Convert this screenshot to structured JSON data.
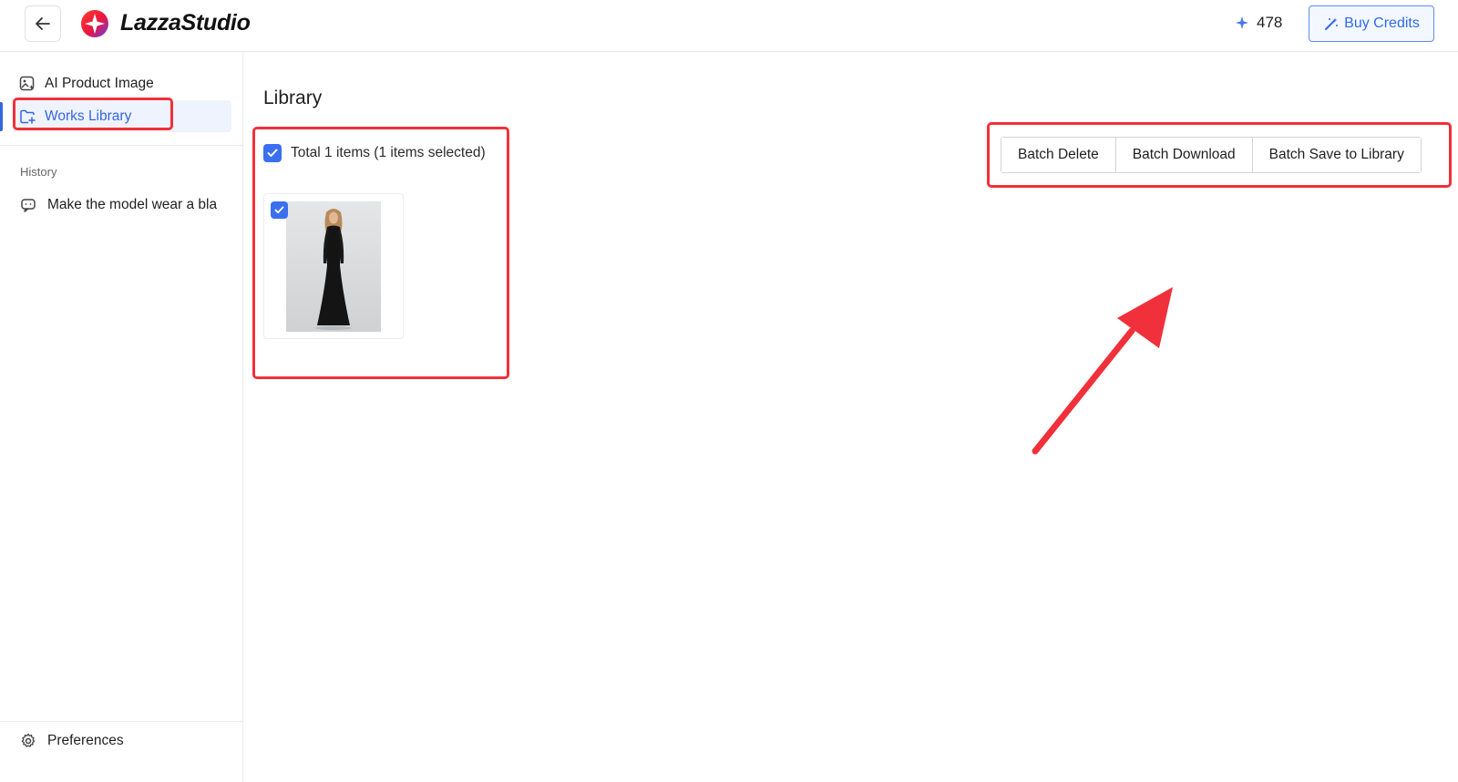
{
  "header": {
    "brand": "LazzaStudio",
    "credits": "478",
    "buy_label": "Buy Credits"
  },
  "sidebar": {
    "items": [
      {
        "label": "AI Product Image",
        "icon": "ai-image-icon"
      },
      {
        "label": "Works Library",
        "icon": "library-folder-icon",
        "active": true
      }
    ],
    "history_label": "History",
    "history_items": [
      {
        "label": "Make the model wear a bla",
        "icon": "chat-bubble-icon"
      }
    ],
    "preferences_label": "Preferences"
  },
  "main": {
    "title": "Library",
    "selection_text": "Total 1 items (1 items selected)",
    "batch_buttons": [
      "Batch Delete",
      "Batch Download",
      "Batch Save to Library"
    ]
  },
  "colors": {
    "accent": "#3566e0",
    "highlight": "#f0303a"
  }
}
